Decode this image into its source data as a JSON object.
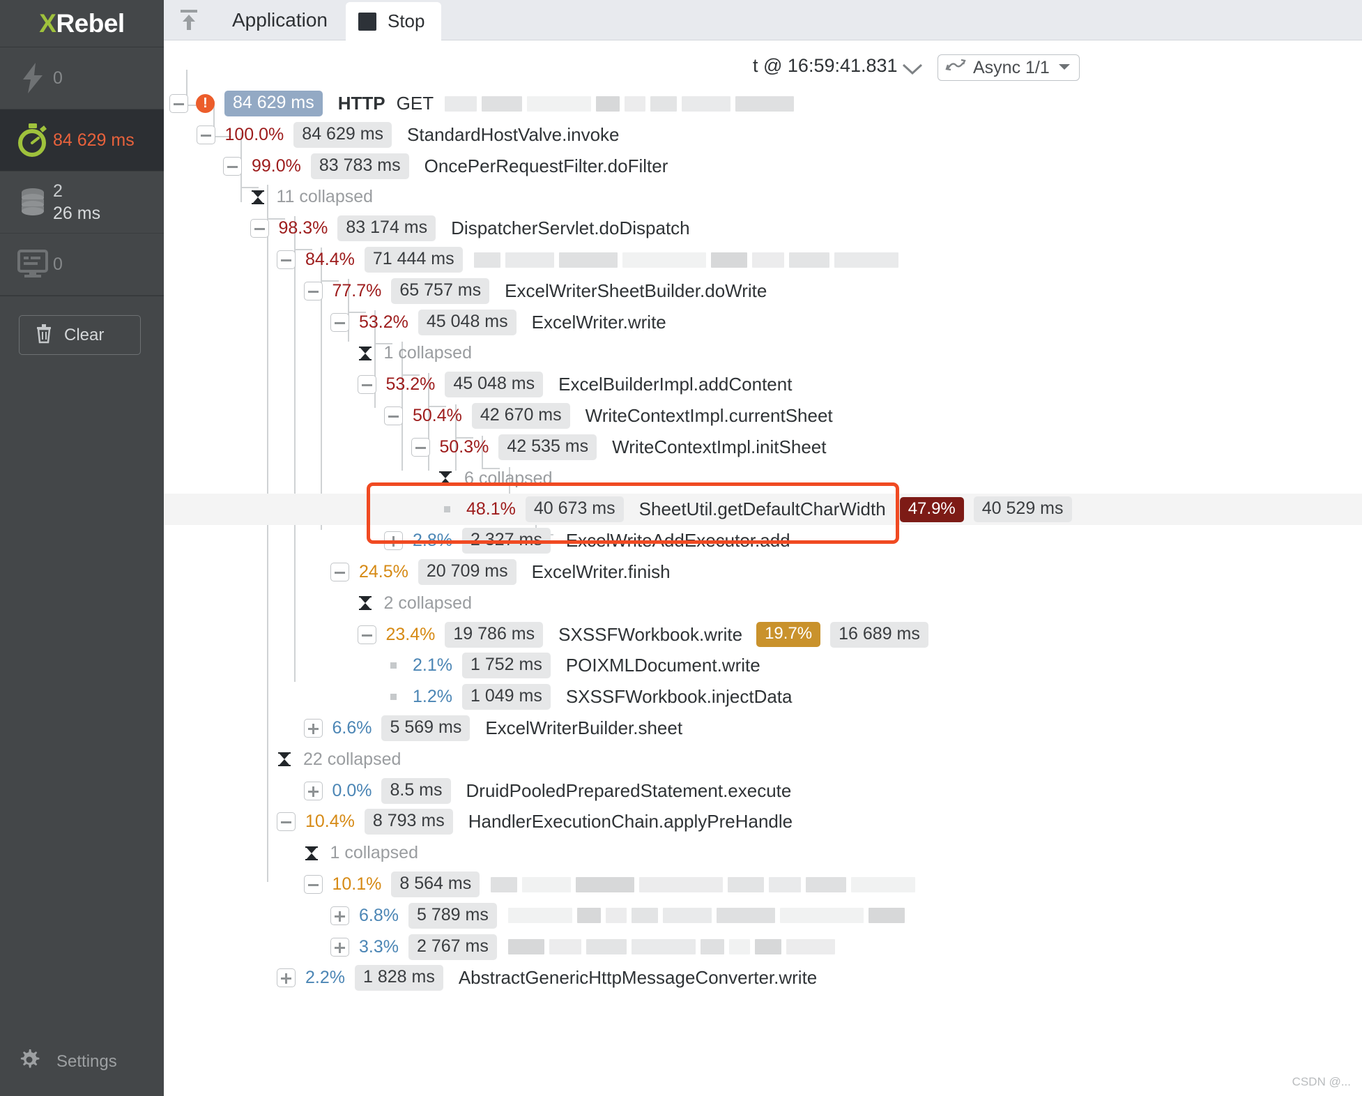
{
  "app": {
    "brand_x": "X",
    "brand_rest": "Rebel"
  },
  "sidebar": {
    "metrics": [
      {
        "icon": "lightning-icon",
        "value": "0",
        "sub": "",
        "state": "dim"
      },
      {
        "icon": "stopwatch-icon",
        "value": "84 629 ms",
        "sub": "",
        "state": "active"
      },
      {
        "icon": "database-icon",
        "value": "2",
        "sub": "26 ms",
        "state": "normal"
      },
      {
        "icon": "monitor-icon",
        "value": "0",
        "sub": "",
        "state": "dim"
      }
    ],
    "clear_label": "Clear",
    "settings_label": "Settings"
  },
  "toolbar": {
    "upload_icon": "upload-icon",
    "application_label": "Application",
    "stop_label": "Stop"
  },
  "header": {
    "root_time": "84 629 ms",
    "protocol": "HTTP",
    "method": "GET",
    "url_redacted": true,
    "timestamp": "t @ 16:59:41.831",
    "chevron": "chevron-down-icon",
    "async_label": "Async 1/1",
    "async_icon": "async-icon",
    "async_caret": "caret-down-icon"
  },
  "tree": {
    "rows": [
      {
        "id": "r0",
        "depth": 0,
        "toggle": "minus",
        "error": true,
        "pill": "blue",
        "pct": "",
        "pct_color": "",
        "ms": "84 629 ms",
        "name": "HTTP",
        "name2": "GET",
        "bold": true,
        "redacted": true
      },
      {
        "id": "r1",
        "depth": 1,
        "toggle": "minus",
        "pct": "100.0%",
        "pct_color": "red",
        "ms": "84 629 ms",
        "name": "StandardHostValve.invoke"
      },
      {
        "id": "r2",
        "depth": 2,
        "toggle": "minus",
        "pct": "99.0%",
        "pct_color": "red",
        "ms": "83 783 ms",
        "name": "OncePerRequestFilter.doFilter"
      },
      {
        "id": "r3",
        "depth": 3,
        "toggle": "collapsed",
        "collapsed_label": "11 collapsed"
      },
      {
        "id": "r4",
        "depth": 3,
        "toggle": "minus",
        "pct": "98.3%",
        "pct_color": "red",
        "ms": "83 174 ms",
        "name": "DispatcherServlet.doDispatch"
      },
      {
        "id": "r5",
        "depth": 4,
        "toggle": "minus",
        "pct": "84.4%",
        "pct_color": "red",
        "ms": "71 444 ms",
        "name": "",
        "redacted": true
      },
      {
        "id": "r6",
        "depth": 5,
        "toggle": "minus",
        "pct": "77.7%",
        "pct_color": "red",
        "ms": "65 757 ms",
        "name": "ExcelWriterSheetBuilder.doWrite"
      },
      {
        "id": "r7",
        "depth": 6,
        "toggle": "minus",
        "pct": "53.2%",
        "pct_color": "red",
        "ms": "45 048 ms",
        "name": "ExcelWriter.write"
      },
      {
        "id": "r8",
        "depth": 7,
        "toggle": "collapsed",
        "collapsed_label": "1 collapsed"
      },
      {
        "id": "r9",
        "depth": 7,
        "toggle": "minus",
        "pct": "53.2%",
        "pct_color": "red",
        "ms": "45 048 ms",
        "name": "ExcelBuilderImpl.addContent"
      },
      {
        "id": "r10",
        "depth": 8,
        "toggle": "minus",
        "pct": "50.4%",
        "pct_color": "red",
        "ms": "42 670 ms",
        "name": "WriteContextImpl.currentSheet"
      },
      {
        "id": "r11",
        "depth": 9,
        "toggle": "minus",
        "pct": "50.3%",
        "pct_color": "red",
        "ms": "42 535 ms",
        "name": "WriteContextImpl.initSheet"
      },
      {
        "id": "r12",
        "depth": 10,
        "toggle": "collapsed",
        "collapsed_label": "6 collapsed"
      },
      {
        "id": "r13",
        "depth": 10,
        "toggle": "leaf",
        "pct": "48.1%",
        "pct_color": "red",
        "ms": "40 673 ms",
        "name": "SheetUtil.getDefaultCharWidth",
        "self_pct": "47.9%",
        "self_ms": "40 529 ms",
        "self_style": "dark-red",
        "highlight": true
      },
      {
        "id": "r14",
        "depth": 8,
        "toggle": "plus",
        "pct": "2.8%",
        "pct_color": "blue",
        "ms": "2 327 ms",
        "name": "ExcelWriteAddExecutor.add"
      },
      {
        "id": "r15",
        "depth": 6,
        "toggle": "minus",
        "pct": "24.5%",
        "pct_color": "orange",
        "ms": "20 709 ms",
        "name": "ExcelWriter.finish"
      },
      {
        "id": "r16",
        "depth": 7,
        "toggle": "collapsed",
        "collapsed_label": "2 collapsed"
      },
      {
        "id": "r17",
        "depth": 7,
        "toggle": "minus",
        "pct": "23.4%",
        "pct_color": "orange",
        "ms": "19 786 ms",
        "name": "SXSSFWorkbook.write",
        "self_pct": "19.7%",
        "self_ms": "16 689 ms",
        "self_style": "amber"
      },
      {
        "id": "r18",
        "depth": 8,
        "toggle": "leaf",
        "pct": "2.1%",
        "pct_color": "blue",
        "ms": "1 752 ms",
        "name": "POIXMLDocument.write"
      },
      {
        "id": "r19",
        "depth": 8,
        "toggle": "leaf",
        "pct": "1.2%",
        "pct_color": "blue",
        "ms": "1 049 ms",
        "name": "SXSSFWorkbook.injectData"
      },
      {
        "id": "r20",
        "depth": 5,
        "toggle": "plus",
        "pct": "6.6%",
        "pct_color": "blue",
        "ms": "5 569 ms",
        "name": "ExcelWriterBuilder.sheet"
      },
      {
        "id": "r21",
        "depth": 4,
        "toggle": "collapsed",
        "collapsed_label": "22 collapsed"
      },
      {
        "id": "r22",
        "depth": 5,
        "toggle": "plus",
        "pct": "0.0%",
        "pct_color": "blue",
        "ms": "8.5 ms",
        "name": "DruidPooledPreparedStatement.execute"
      },
      {
        "id": "r23",
        "depth": 4,
        "toggle": "minus",
        "pct": "10.4%",
        "pct_color": "orange",
        "ms": "8 793 ms",
        "name": "HandlerExecutionChain.applyPreHandle"
      },
      {
        "id": "r24",
        "depth": 5,
        "toggle": "collapsed",
        "collapsed_label": "1 collapsed"
      },
      {
        "id": "r25",
        "depth": 5,
        "toggle": "minus",
        "pct": "10.1%",
        "pct_color": "orange",
        "ms": "8 564 ms",
        "name": "",
        "redacted": true
      },
      {
        "id": "r26",
        "depth": 6,
        "toggle": "plus",
        "pct": "6.8%",
        "pct_color": "blue",
        "ms": "5 789 ms",
        "name": "",
        "redacted": true
      },
      {
        "id": "r27",
        "depth": 6,
        "toggle": "plus",
        "pct": "3.3%",
        "pct_color": "blue",
        "ms": "2 767 ms",
        "name": "",
        "redacted": true
      },
      {
        "id": "r28",
        "depth": 4,
        "toggle": "plus",
        "pct": "2.2%",
        "pct_color": "blue",
        "ms": "1 828 ms",
        "name": "AbstractGenericHttpMessageConverter.write"
      }
    ]
  },
  "colors": {
    "brand_green": "#9fc23c",
    "accent_orange": "#e8623c",
    "highlight_box": "#f04a22",
    "pct_red": "#9d1c1c",
    "pct_orange": "#d68a15",
    "pct_blue": "#4c86b5",
    "self_dark_red": "#7d1b16",
    "self_amber": "#c9922c",
    "sidebar_bg": "#444749",
    "toolbar_bg": "#e8eaee"
  },
  "watermark": "CSDN @..."
}
